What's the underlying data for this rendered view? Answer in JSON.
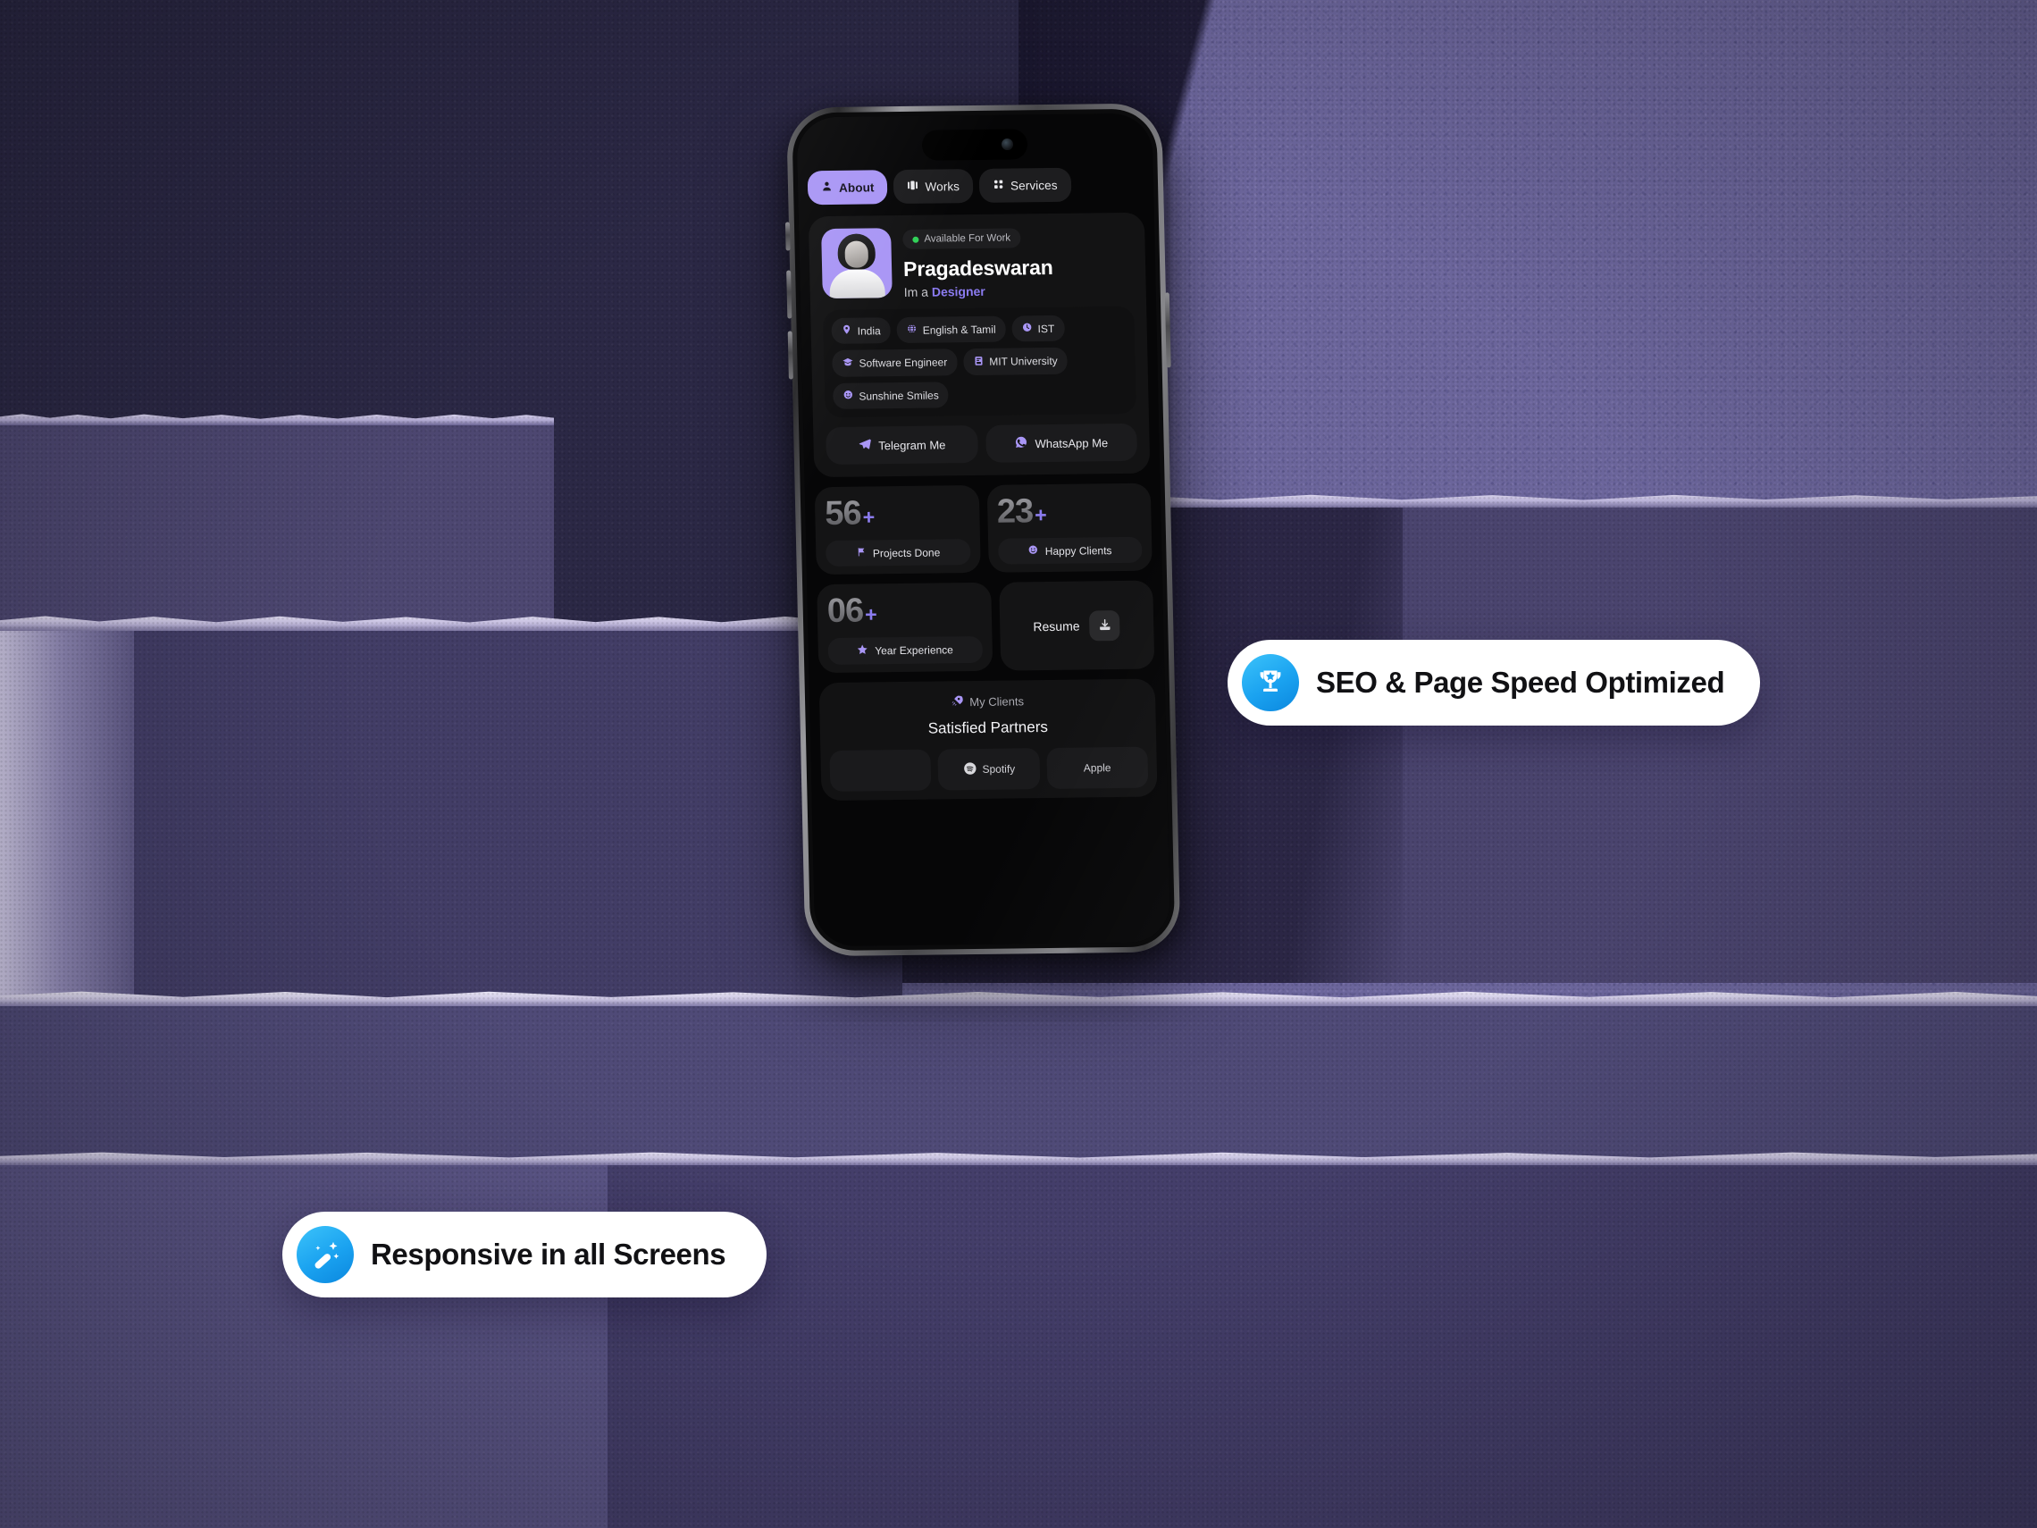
{
  "app": {
    "tabs": [
      {
        "label": "About",
        "icon": "person-icon",
        "active": true
      },
      {
        "label": "Works",
        "icon": "columns-icon",
        "active": false
      },
      {
        "label": "Services",
        "icon": "grid-4-icon",
        "active": false
      }
    ],
    "profile": {
      "availability": "Available For Work",
      "name": "Pragadeswaran",
      "role_prefix": "Im a ",
      "role": "Designer"
    },
    "tags": [
      {
        "label": "India",
        "icon": "location-pin-icon"
      },
      {
        "label": "English & Tamil",
        "icon": "globe-icon"
      },
      {
        "label": "IST",
        "icon": "clock-icon"
      },
      {
        "label": "Software Engineer",
        "icon": "graduation-cap-icon"
      },
      {
        "label": "MIT University",
        "icon": "building-icon"
      },
      {
        "label": "Sunshine Smiles",
        "icon": "smiley-icon"
      }
    ],
    "contacts": [
      {
        "label": "Telegram Me",
        "icon": "telegram-icon"
      },
      {
        "label": "WhatsApp Me",
        "icon": "whatsapp-icon"
      }
    ],
    "stats": [
      {
        "value": "56",
        "suffix": "+",
        "label": "Projects Done",
        "icon": "flag-icon"
      },
      {
        "value": "23",
        "suffix": "+",
        "label": "Happy Clients",
        "icon": "smiley-icon"
      },
      {
        "value": "06",
        "suffix": "+",
        "label": "Year Experience",
        "icon": "star-icon"
      }
    ],
    "resume": {
      "label": "Resume",
      "icon": "download-icon"
    },
    "clients": {
      "label": "My Clients",
      "icon": "rocket-icon",
      "title": "Satisfied Partners",
      "logos": [
        "",
        "Spotify",
        "Apple"
      ]
    }
  },
  "pills": [
    {
      "text": "SEO & Page Speed Optimized",
      "icon": "trophy-icon"
    },
    {
      "text": "Responsive in all Screens",
      "icon": "magic-wand-icon"
    }
  ],
  "colors": {
    "accent_purple": "#a996f5",
    "role_purple": "#8b7bf0",
    "pill_blue": "#1aa2f0",
    "status_green": "#31d158",
    "screen_bg": "#060607",
    "card_bg": "#131314",
    "wall_dark": "#2b2845",
    "wall_light": "#6b659b",
    "stone": "#4d4771"
  }
}
